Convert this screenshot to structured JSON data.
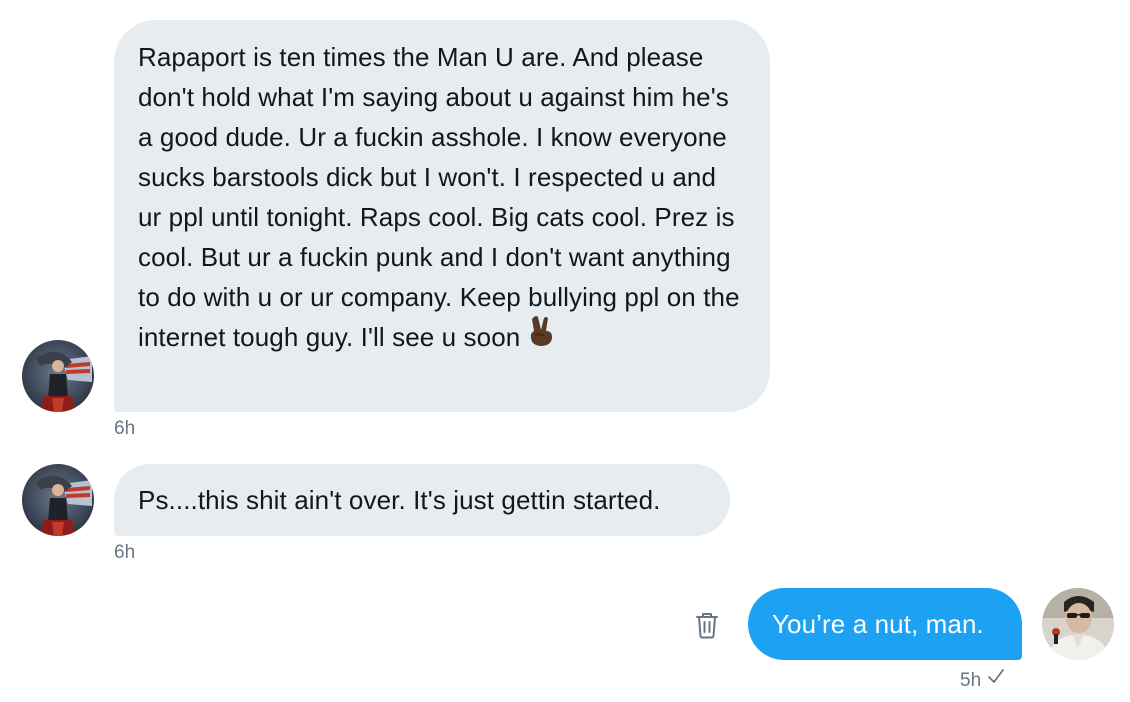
{
  "conversation": {
    "messages": [
      {
        "direction": "received",
        "text": "Rapaport is ten times the Man U are. And please don't hold what I'm saying about u against him he's a good dude. Ur a fuckin asshole. I know everyone sucks barstools dick but I won't. I respected u and ur ppl until tonight.  Raps cool. Big cats cool. Prez is cool. But ur a fuckin punk and I don't want anything to do with u or ur company. Keep bullying ppl on the internet tough guy. I'll see u soon",
        "emoji": "victory-hand-dark-skin",
        "timestamp": "6h"
      },
      {
        "direction": "received",
        "text": "Ps....this shit ain't over. It's just gettin started.",
        "timestamp": "6h"
      },
      {
        "direction": "sent",
        "text": "You’re a nut, man.",
        "timestamp": "5h",
        "status_icon": "check-icon"
      }
    ]
  },
  "icons": {
    "delete": "trash-icon",
    "read_receipt": "check-icon"
  },
  "colors": {
    "received_bubble": "#e6ecf0",
    "sent_bubble": "#1da1f2",
    "timestamp": "#657786",
    "text": "#14171a"
  }
}
